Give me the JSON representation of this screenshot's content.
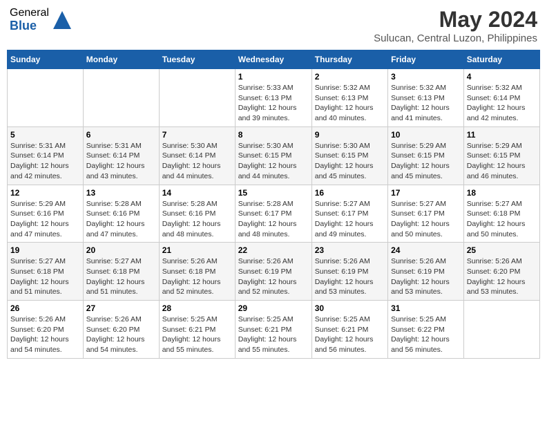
{
  "logo": {
    "general": "General",
    "blue": "Blue"
  },
  "title": "May 2024",
  "subtitle": "Sulucan, Central Luzon, Philippines",
  "days_of_week": [
    "Sunday",
    "Monday",
    "Tuesday",
    "Wednesday",
    "Thursday",
    "Friday",
    "Saturday"
  ],
  "weeks": [
    [
      {
        "day": "",
        "info": ""
      },
      {
        "day": "",
        "info": ""
      },
      {
        "day": "",
        "info": ""
      },
      {
        "day": "1",
        "sunrise": "5:33 AM",
        "sunset": "6:13 PM",
        "daylight": "12 hours and 39 minutes."
      },
      {
        "day": "2",
        "sunrise": "5:32 AM",
        "sunset": "6:13 PM",
        "daylight": "12 hours and 40 minutes."
      },
      {
        "day": "3",
        "sunrise": "5:32 AM",
        "sunset": "6:13 PM",
        "daylight": "12 hours and 41 minutes."
      },
      {
        "day": "4",
        "sunrise": "5:32 AM",
        "sunset": "6:14 PM",
        "daylight": "12 hours and 42 minutes."
      }
    ],
    [
      {
        "day": "5",
        "sunrise": "5:31 AM",
        "sunset": "6:14 PM",
        "daylight": "12 hours and 42 minutes."
      },
      {
        "day": "6",
        "sunrise": "5:31 AM",
        "sunset": "6:14 PM",
        "daylight": "12 hours and 43 minutes."
      },
      {
        "day": "7",
        "sunrise": "5:30 AM",
        "sunset": "6:14 PM",
        "daylight": "12 hours and 44 minutes."
      },
      {
        "day": "8",
        "sunrise": "5:30 AM",
        "sunset": "6:15 PM",
        "daylight": "12 hours and 44 minutes."
      },
      {
        "day": "9",
        "sunrise": "5:30 AM",
        "sunset": "6:15 PM",
        "daylight": "12 hours and 45 minutes."
      },
      {
        "day": "10",
        "sunrise": "5:29 AM",
        "sunset": "6:15 PM",
        "daylight": "12 hours and 45 minutes."
      },
      {
        "day": "11",
        "sunrise": "5:29 AM",
        "sunset": "6:15 PM",
        "daylight": "12 hours and 46 minutes."
      }
    ],
    [
      {
        "day": "12",
        "sunrise": "5:29 AM",
        "sunset": "6:16 PM",
        "daylight": "12 hours and 47 minutes."
      },
      {
        "day": "13",
        "sunrise": "5:28 AM",
        "sunset": "6:16 PM",
        "daylight": "12 hours and 47 minutes."
      },
      {
        "day": "14",
        "sunrise": "5:28 AM",
        "sunset": "6:16 PM",
        "daylight": "12 hours and 48 minutes."
      },
      {
        "day": "15",
        "sunrise": "5:28 AM",
        "sunset": "6:17 PM",
        "daylight": "12 hours and 48 minutes."
      },
      {
        "day": "16",
        "sunrise": "5:27 AM",
        "sunset": "6:17 PM",
        "daylight": "12 hours and 49 minutes."
      },
      {
        "day": "17",
        "sunrise": "5:27 AM",
        "sunset": "6:17 PM",
        "daylight": "12 hours and 50 minutes."
      },
      {
        "day": "18",
        "sunrise": "5:27 AM",
        "sunset": "6:18 PM",
        "daylight": "12 hours and 50 minutes."
      }
    ],
    [
      {
        "day": "19",
        "sunrise": "5:27 AM",
        "sunset": "6:18 PM",
        "daylight": "12 hours and 51 minutes."
      },
      {
        "day": "20",
        "sunrise": "5:27 AM",
        "sunset": "6:18 PM",
        "daylight": "12 hours and 51 minutes."
      },
      {
        "day": "21",
        "sunrise": "5:26 AM",
        "sunset": "6:18 PM",
        "daylight": "12 hours and 52 minutes."
      },
      {
        "day": "22",
        "sunrise": "5:26 AM",
        "sunset": "6:19 PM",
        "daylight": "12 hours and 52 minutes."
      },
      {
        "day": "23",
        "sunrise": "5:26 AM",
        "sunset": "6:19 PM",
        "daylight": "12 hours and 53 minutes."
      },
      {
        "day": "24",
        "sunrise": "5:26 AM",
        "sunset": "6:19 PM",
        "daylight": "12 hours and 53 minutes."
      },
      {
        "day": "25",
        "sunrise": "5:26 AM",
        "sunset": "6:20 PM",
        "daylight": "12 hours and 53 minutes."
      }
    ],
    [
      {
        "day": "26",
        "sunrise": "5:26 AM",
        "sunset": "6:20 PM",
        "daylight": "12 hours and 54 minutes."
      },
      {
        "day": "27",
        "sunrise": "5:26 AM",
        "sunset": "6:20 PM",
        "daylight": "12 hours and 54 minutes."
      },
      {
        "day": "28",
        "sunrise": "5:25 AM",
        "sunset": "6:21 PM",
        "daylight": "12 hours and 55 minutes."
      },
      {
        "day": "29",
        "sunrise": "5:25 AM",
        "sunset": "6:21 PM",
        "daylight": "12 hours and 55 minutes."
      },
      {
        "day": "30",
        "sunrise": "5:25 AM",
        "sunset": "6:21 PM",
        "daylight": "12 hours and 56 minutes."
      },
      {
        "day": "31",
        "sunrise": "5:25 AM",
        "sunset": "6:22 PM",
        "daylight": "12 hours and 56 minutes."
      },
      {
        "day": "",
        "info": ""
      }
    ]
  ],
  "labels": {
    "sunrise": "Sunrise:",
    "sunset": "Sunset:",
    "daylight": "Daylight:"
  }
}
